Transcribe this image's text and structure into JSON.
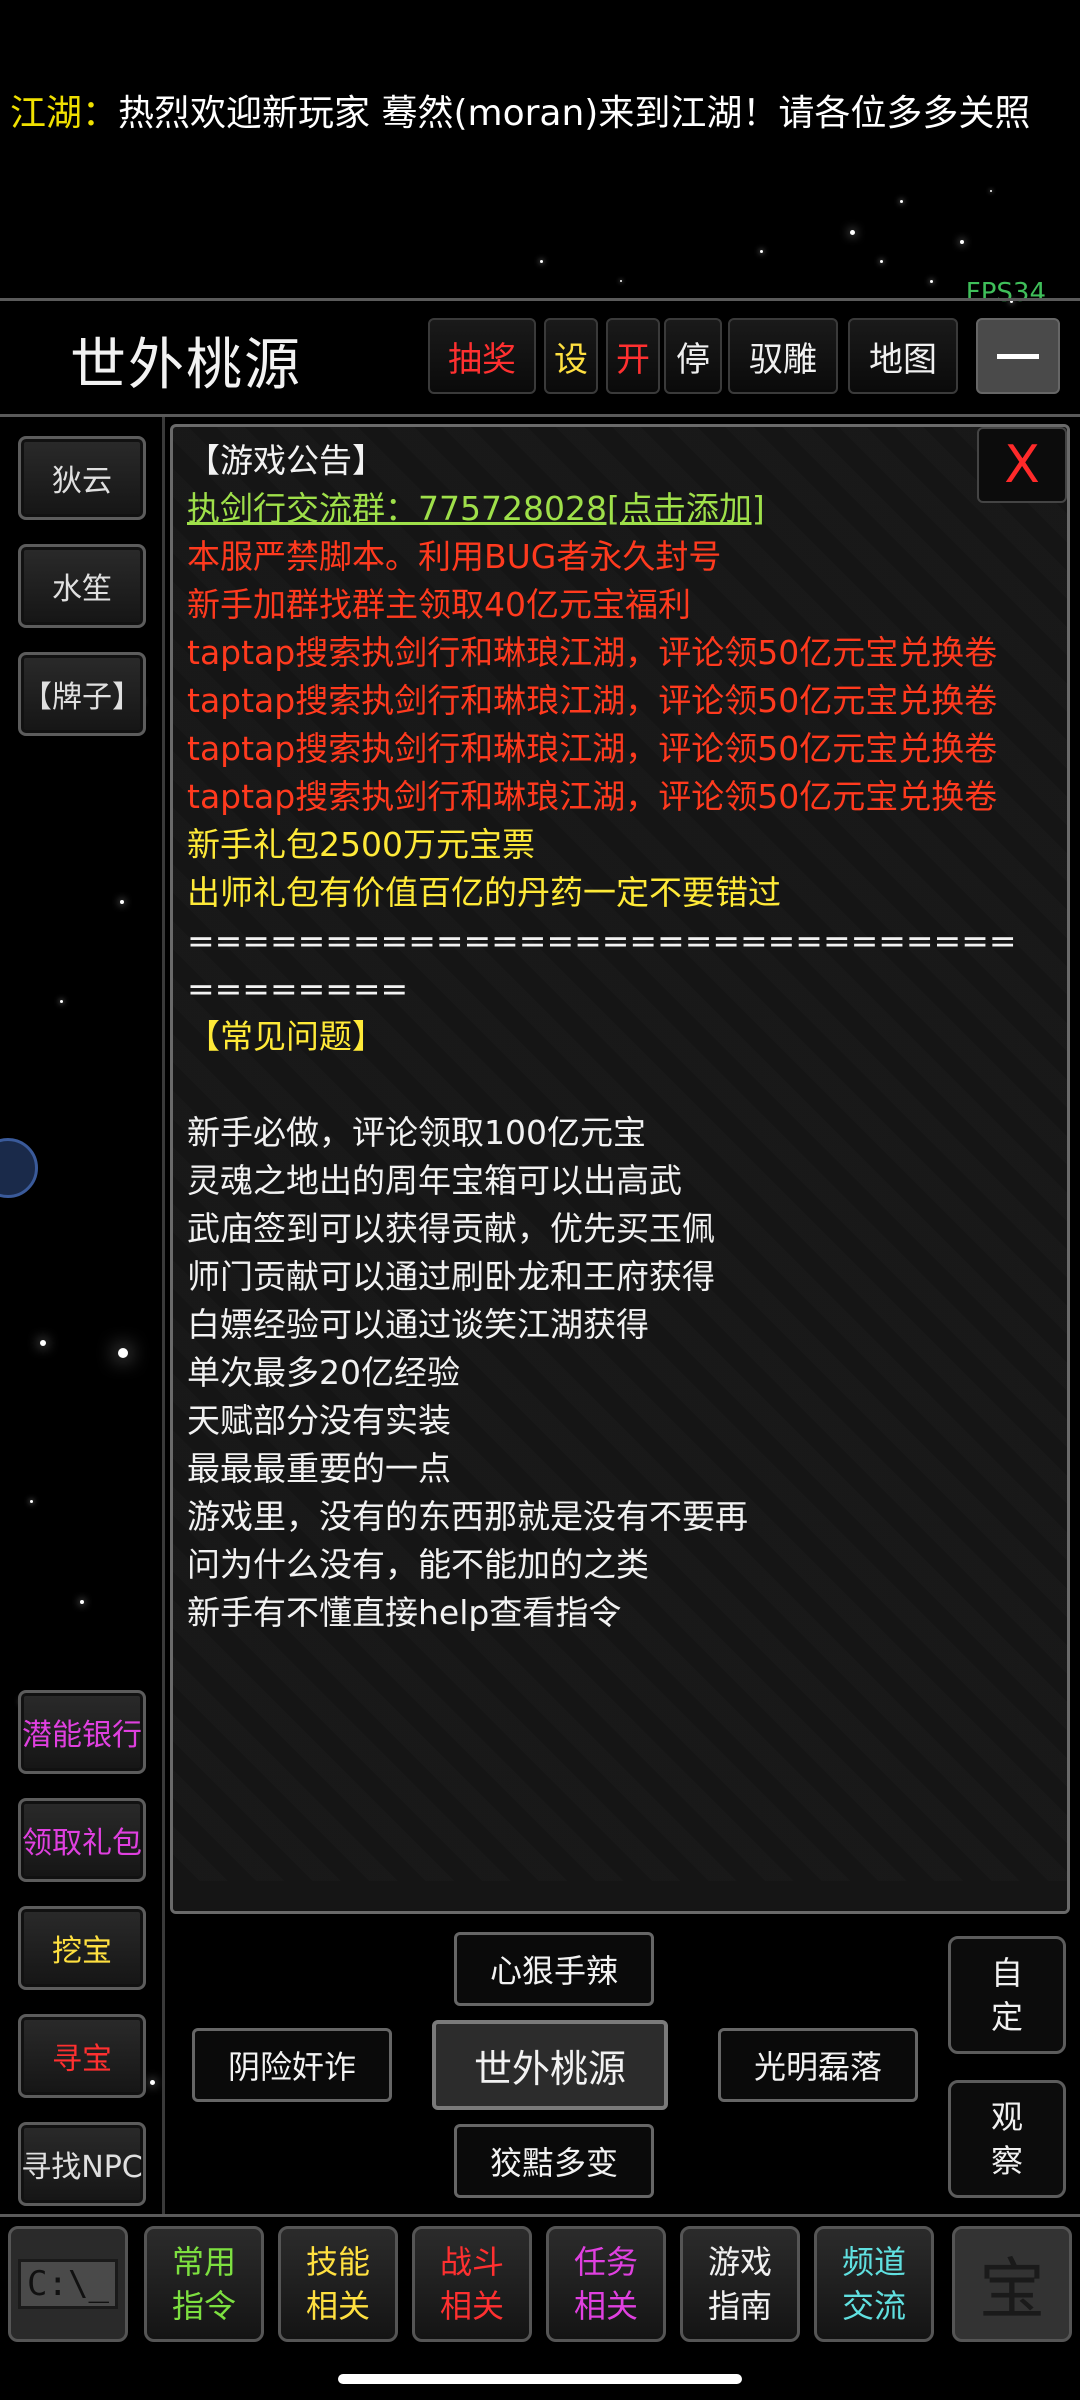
{
  "ticker": {
    "channel": "江湖：",
    "message": "热烈欢迎新玩家  蓦然(moran)来到江湖！请各位多多关照"
  },
  "fps": "FPS34",
  "header": {
    "location": "世外桃源",
    "buttons": [
      {
        "label": "抽奖",
        "color": "#ff3030"
      },
      {
        "label": "设",
        "color": "#ffe040"
      },
      {
        "label": "开",
        "color": "#ff3030"
      },
      {
        "label": "停",
        "color": "#f0f0f0"
      },
      {
        "label": "驭雕",
        "color": "#f0f0f0"
      },
      {
        "label": "地图",
        "color": "#f0f0f0"
      }
    ]
  },
  "left_top": [
    "狄云",
    "水笙",
    "【牌子】"
  ],
  "left_bottom": [
    {
      "label": "潜能银行",
      "color": "#e040e0"
    },
    {
      "label": "领取礼包",
      "color": "#e040e0"
    },
    {
      "label": "挖宝",
      "color": "#ffe040"
    },
    {
      "label": "寻宝",
      "color": "#ff3030"
    },
    {
      "label": "寻找NPC",
      "color": "#f0f0f0"
    }
  ],
  "notice": {
    "close": "X",
    "lines": [
      {
        "text": "【游戏公告】",
        "style": "white"
      },
      {
        "text": "执剑行交流群：775728028[点击添加]",
        "style": "green"
      },
      {
        "text": "本服严禁脚本。利用BUG者永久封号",
        "style": "red"
      },
      {
        "text": "新手加群找群主领取40亿元宝福利",
        "style": "red"
      },
      {
        "text": "taptap搜索执剑行和琳琅江湖，评论领50亿元宝兑换卷",
        "style": "red"
      },
      {
        "text": "taptap搜索执剑行和琳琅江湖，评论领50亿元宝兑换卷",
        "style": "red"
      },
      {
        "text": "taptap搜索执剑行和琳琅江湖，评论领50亿元宝兑换卷",
        "style": "red"
      },
      {
        "text": "taptap搜索执剑行和琳琅江湖，评论领50亿元宝兑换卷",
        "style": "red"
      },
      {
        "text": "新手礼包2500万元宝票",
        "style": "yellow"
      },
      {
        "text": "出师礼包有价值百亿的丹药一定不要错过",
        "style": "yellow"
      },
      {
        "text": "======================================",
        "style": "white"
      },
      {
        "text": "【常见问题】",
        "style": "yellow"
      },
      {
        "text": "",
        "style": "blank"
      },
      {
        "text": "新手必做，评论领取100亿元宝",
        "style": "white"
      },
      {
        "text": "灵魂之地出的周年宝箱可以出高武",
        "style": "white"
      },
      {
        "text": "武庙签到可以获得贡献，优先买玉佩",
        "style": "white"
      },
      {
        "text": "师门贡献可以通过刷卧龙和王府获得",
        "style": "white"
      },
      {
        "text": "白嫖经验可以通过谈笑江湖获得",
        "style": "white"
      },
      {
        "text": "单次最多20亿经验",
        "style": "white"
      },
      {
        "text": "天赋部分没有实装",
        "style": "white"
      },
      {
        "text": "最最最重要的一点",
        "style": "white"
      },
      {
        "text": "游戏里，没有的东西那就是没有不要再",
        "style": "white"
      },
      {
        "text": "问为什么没有，能不能加的之类",
        "style": "white"
      },
      {
        "text": "新手有不懂直接help查看指令",
        "style": "white"
      }
    ]
  },
  "compass": {
    "north": "心狠手辣",
    "west": "阴险奸诈",
    "center": "世外桃源",
    "east": "光明磊落",
    "south": "狡黠多变"
  },
  "right_buttons": [
    "自定",
    "观察"
  ],
  "bottom_bar": [
    {
      "line1": "常用",
      "line2": "指令",
      "color": "#7de040"
    },
    {
      "line1": "技能",
      "line2": "相关",
      "color": "#ffe040"
    },
    {
      "line1": "战斗",
      "line2": "相关",
      "color": "#ff3030"
    },
    {
      "line1": "任务",
      "line2": "相关",
      "color": "#e040e0"
    },
    {
      "line1": "游戏",
      "line2": "指南",
      "color": "#f0f0f0"
    },
    {
      "line1": "频道",
      "line2": "交流",
      "color": "#60e0e0"
    }
  ],
  "cmd_icon": "C:\\_",
  "treasure_icon": "宝"
}
